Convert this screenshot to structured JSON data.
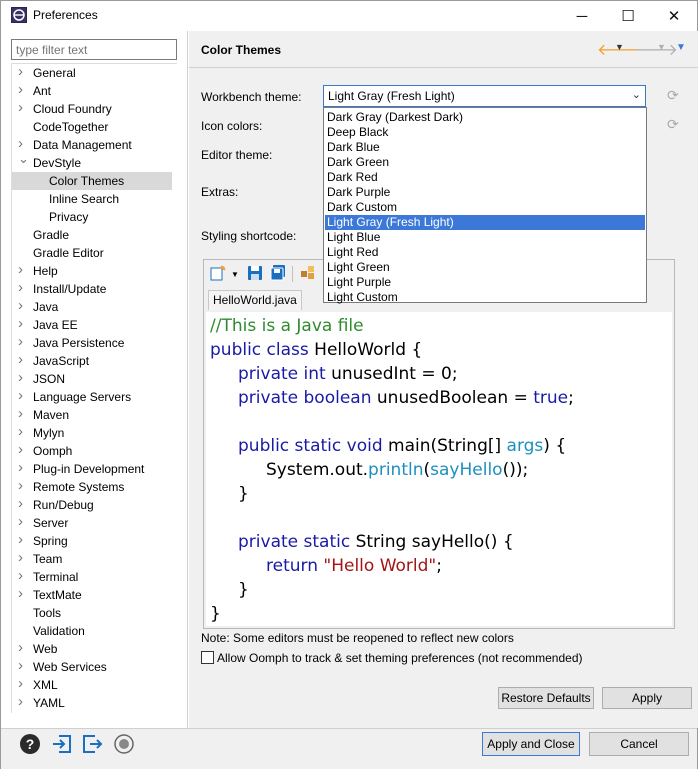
{
  "window": {
    "title": "Preferences",
    "minimize": "─",
    "maximize": "☐",
    "close": "✕"
  },
  "filter": {
    "placeholder": "type filter text"
  },
  "tree": {
    "items": [
      {
        "label": "General",
        "arrow": ">",
        "level": 0,
        "selected": false
      },
      {
        "label": "Ant",
        "arrow": ">",
        "level": 0,
        "selected": false
      },
      {
        "label": "Cloud Foundry",
        "arrow": ">",
        "level": 0,
        "selected": false
      },
      {
        "label": "CodeTogether",
        "arrow": "",
        "level": 0,
        "selected": false
      },
      {
        "label": "Data Management",
        "arrow": ">",
        "level": 0,
        "selected": false
      },
      {
        "label": "DevStyle",
        "arrow": "v",
        "level": 0,
        "selected": false
      },
      {
        "label": "Color Themes",
        "arrow": "",
        "level": 1,
        "selected": true
      },
      {
        "label": "Inline Search",
        "arrow": "",
        "level": 1,
        "selected": false
      },
      {
        "label": "Privacy",
        "arrow": "",
        "level": 1,
        "selected": false
      },
      {
        "label": "Gradle",
        "arrow": "",
        "level": 0,
        "selected": false
      },
      {
        "label": "Gradle Editor",
        "arrow": "",
        "level": 0,
        "selected": false
      },
      {
        "label": "Help",
        "arrow": ">",
        "level": 0,
        "selected": false
      },
      {
        "label": "Install/Update",
        "arrow": ">",
        "level": 0,
        "selected": false
      },
      {
        "label": "Java",
        "arrow": ">",
        "level": 0,
        "selected": false
      },
      {
        "label": "Java EE",
        "arrow": ">",
        "level": 0,
        "selected": false
      },
      {
        "label": "Java Persistence",
        "arrow": ">",
        "level": 0,
        "selected": false
      },
      {
        "label": "JavaScript",
        "arrow": ">",
        "level": 0,
        "selected": false
      },
      {
        "label": "JSON",
        "arrow": ">",
        "level": 0,
        "selected": false
      },
      {
        "label": "Language Servers",
        "arrow": ">",
        "level": 0,
        "selected": false
      },
      {
        "label": "Maven",
        "arrow": ">",
        "level": 0,
        "selected": false
      },
      {
        "label": "Mylyn",
        "arrow": ">",
        "level": 0,
        "selected": false
      },
      {
        "label": "Oomph",
        "arrow": ">",
        "level": 0,
        "selected": false
      },
      {
        "label": "Plug-in Development",
        "arrow": ">",
        "level": 0,
        "selected": false
      },
      {
        "label": "Remote Systems",
        "arrow": ">",
        "level": 0,
        "selected": false
      },
      {
        "label": "Run/Debug",
        "arrow": ">",
        "level": 0,
        "selected": false
      },
      {
        "label": "Server",
        "arrow": ">",
        "level": 0,
        "selected": false
      },
      {
        "label": "Spring",
        "arrow": ">",
        "level": 0,
        "selected": false
      },
      {
        "label": "Team",
        "arrow": ">",
        "level": 0,
        "selected": false
      },
      {
        "label": "Terminal",
        "arrow": ">",
        "level": 0,
        "selected": false
      },
      {
        "label": "TextMate",
        "arrow": ">",
        "level": 0,
        "selected": false
      },
      {
        "label": "Tools",
        "arrow": "",
        "level": 0,
        "selected": false
      },
      {
        "label": "Validation",
        "arrow": "",
        "level": 0,
        "selected": false
      },
      {
        "label": "Web",
        "arrow": ">",
        "level": 0,
        "selected": false
      },
      {
        "label": "Web Services",
        "arrow": ">",
        "level": 0,
        "selected": false
      },
      {
        "label": "XML",
        "arrow": ">",
        "level": 0,
        "selected": false
      },
      {
        "label": "YAML",
        "arrow": ">",
        "level": 0,
        "selected": false
      }
    ]
  },
  "page": {
    "title": "Color Themes",
    "labels": {
      "workbench": "Workbench theme:",
      "icon": "Icon colors:",
      "editor": "Editor theme:",
      "extras": "Extras:",
      "shortcode": "Styling shortcode:"
    },
    "workbench_value": "Light Gray (Fresh Light)",
    "dropdown_options": [
      "Dark Gray (Darkest Dark)",
      "Deep Black",
      "Dark Blue",
      "Dark Green",
      "Dark Red",
      "Dark Purple",
      "Dark Custom",
      "Light Gray (Fresh Light)",
      "Light Blue",
      "Light Red",
      "Light Green",
      "Light Purple",
      "Light Custom"
    ],
    "dropdown_selected_index": 7,
    "editor_tab": "HelloWorld.java",
    "code": {
      "l1": "//This is a Java file",
      "l2a": "public class ",
      "l2b": "HelloWorld {",
      "l3a": "private int ",
      "l3b": "unusedInt = 0;",
      "l4a": "private boolean ",
      "l4b": "unusedBoolean = ",
      "l4c": "true",
      "l4d": ";",
      "l6a": "public static void ",
      "l6b": "main(String[] ",
      "l6c": "args",
      "l6d": ") {",
      "l7a": "System.out.",
      "l7b": "println",
      "l7c": "(",
      "l7d": "sayHello",
      "l7e": "());",
      "l8": "}",
      "l10a": "private static ",
      "l10b": "String sayHello() {",
      "l11a": "return ",
      "l11b": "\"Hello World\"",
      "l11c": ";",
      "l12": "}",
      "l13": "}"
    },
    "note": "Note: Some editors must be reopened to reflect new colors",
    "oomph_checkbox": "Allow Oomph to track & set theming preferences (not recommended)",
    "oomph_checked": false,
    "restore_defaults": "Restore Defaults",
    "apply": "Apply"
  },
  "footer": {
    "apply_close": "Apply and Close",
    "cancel": "Cancel"
  },
  "colors": {
    "accent": "#3b78d8",
    "keyword": "#1a1aa6",
    "comment": "#2e8b2e",
    "method": "#1c8fc0",
    "string": "#a31515",
    "nav_arrow": "#f0a030"
  }
}
